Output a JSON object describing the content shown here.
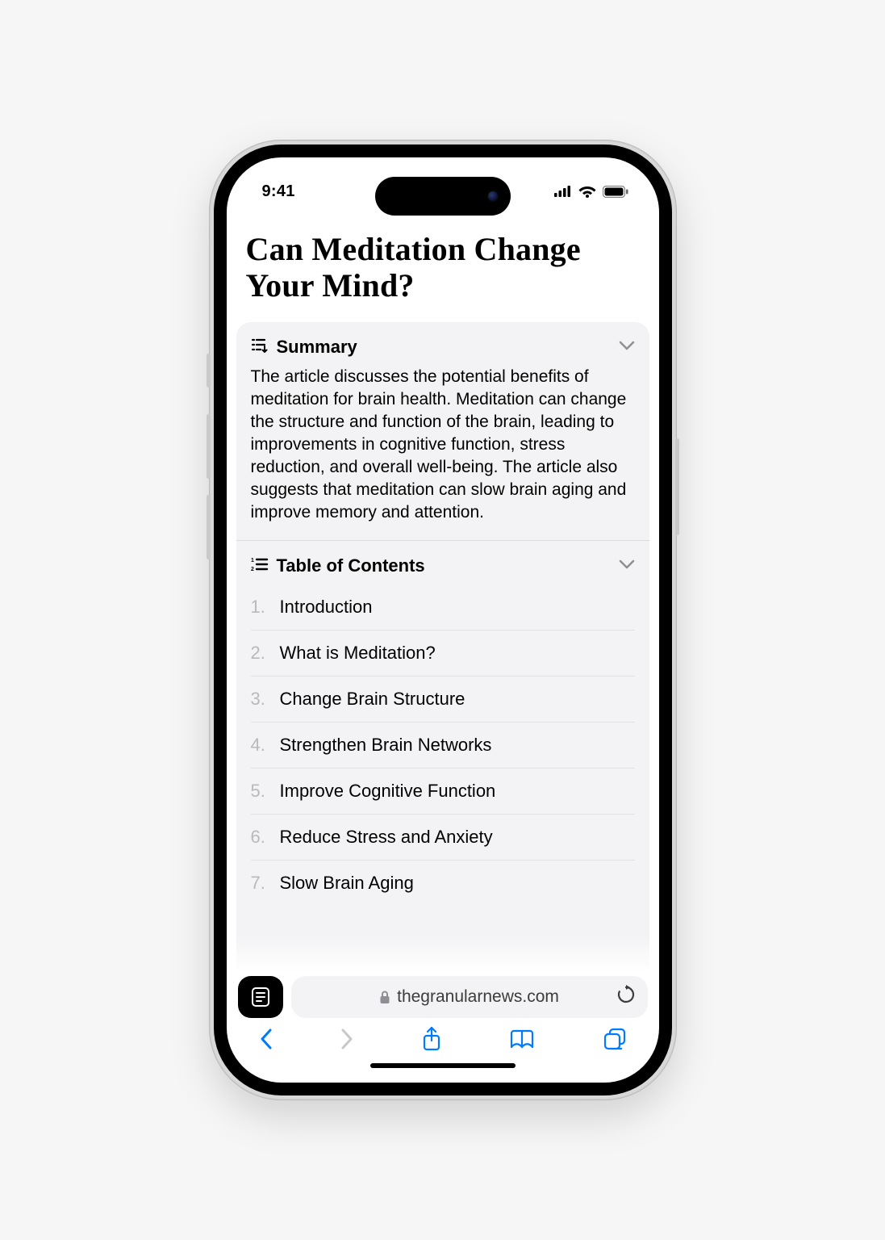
{
  "status": {
    "time": "9:41"
  },
  "article": {
    "title": "Can Meditation Change Your Mind?"
  },
  "summary": {
    "label": "Summary",
    "body": "The article discusses the potential benefits of meditation for brain health. Meditation can change the structure and function of the brain, leading to improvements in cognitive function, stress reduction, and overall well-being. The article also suggests that meditation can slow brain aging and improve memory and attention."
  },
  "toc": {
    "label": "Table of Contents",
    "items": [
      {
        "n": "1.",
        "title": "Introduction"
      },
      {
        "n": "2.",
        "title": "What is Meditation?"
      },
      {
        "n": "3.",
        "title": "Change Brain Structure"
      },
      {
        "n": "4.",
        "title": "Strengthen Brain Networks"
      },
      {
        "n": "5.",
        "title": "Improve Cognitive Function"
      },
      {
        "n": "6.",
        "title": "Reduce Stress and Anxiety"
      },
      {
        "n": "7.",
        "title": "Slow Brain Aging"
      }
    ]
  },
  "url_bar": {
    "domain": "thegranularnews.com"
  }
}
